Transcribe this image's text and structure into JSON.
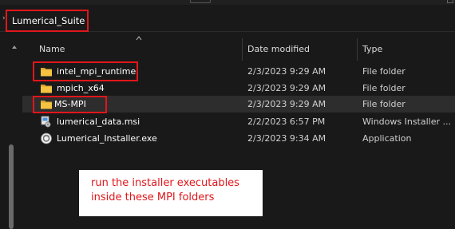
{
  "address_bar": {
    "crumb": "Lumerical_Suite"
  },
  "columns": {
    "name": "Name",
    "date_modified": "Date modified",
    "type": "Type"
  },
  "files": [
    {
      "name": "intel_mpi_runtime",
      "date": "2/3/2023 9:29 AM",
      "type": "File folder",
      "icon": "folder-icon"
    },
    {
      "name": "mpich_x64",
      "date": "2/3/2023 9:29 AM",
      "type": "File folder",
      "icon": "folder-icon"
    },
    {
      "name": "MS-MPI",
      "date": "2/3/2023 9:29 AM",
      "type": "File folder",
      "icon": "folder-icon"
    },
    {
      "name": "lumerical_data.msi",
      "date": "2/2/2023 6:57 PM",
      "type": "Windows Installer ...",
      "icon": "msi-installer-icon"
    },
    {
      "name": "Lumerical_Installer.exe",
      "date": "2/3/2023 9:34 AM",
      "type": "Application",
      "icon": "exe-application-icon"
    }
  ],
  "annotation": {
    "line1": "run the installer executables",
    "line2": "inside these MPI folders"
  },
  "colors": {
    "background": "#191919",
    "selected_row": "#2d2d2d",
    "highlight_red": "#e0161b",
    "folder_yellow": "#f5c342"
  }
}
